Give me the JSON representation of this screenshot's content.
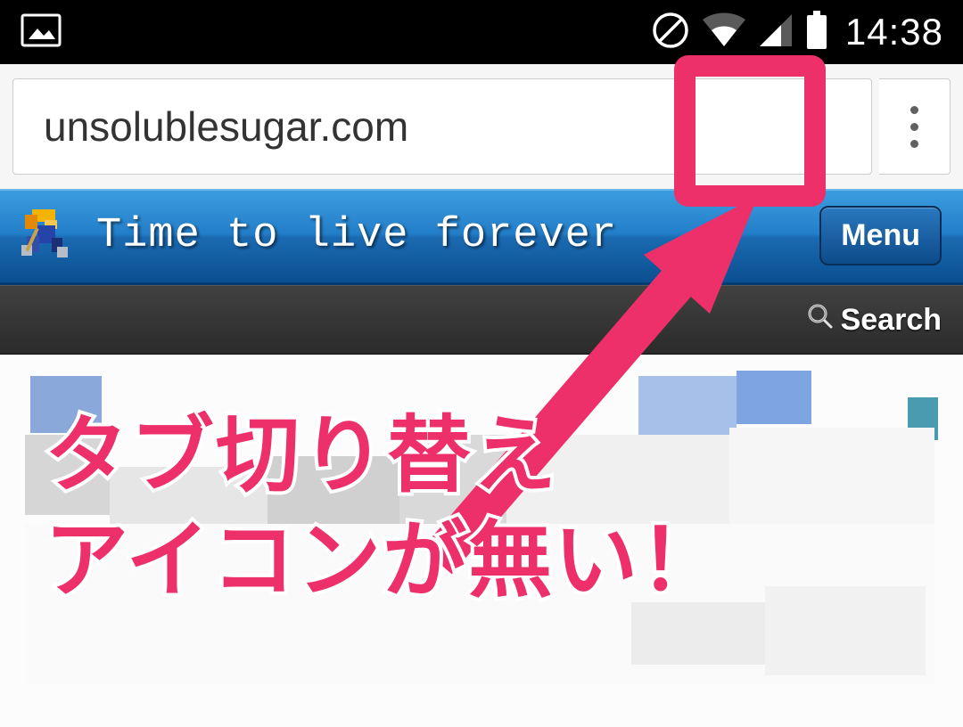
{
  "status_bar": {
    "time": "14:38"
  },
  "browser": {
    "url": "unsolublesugar.com"
  },
  "site": {
    "title": "Time to live forever",
    "menu_label": "Menu"
  },
  "search_strip": {
    "search_label": "Search"
  },
  "annotation": {
    "line1": "タブ切り替え",
    "line2": "アイコンが無い！"
  },
  "colors": {
    "accent": "#ed2f6a"
  }
}
